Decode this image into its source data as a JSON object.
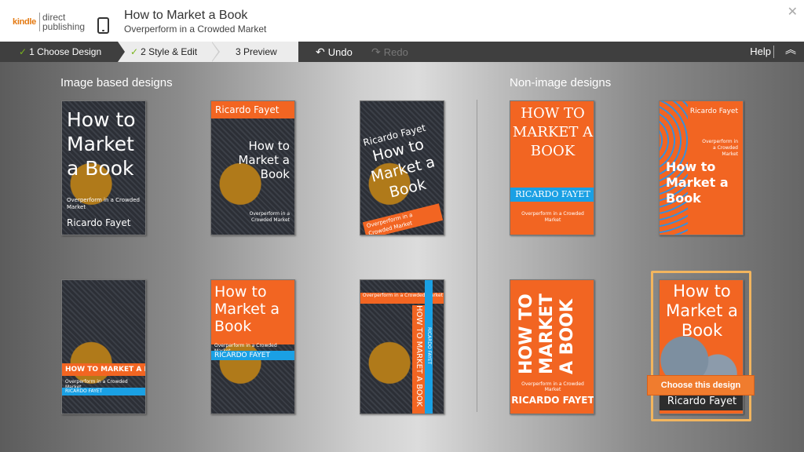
{
  "header": {
    "logo_kindle": "kindle",
    "logo_line1": "direct",
    "logo_line2": "publishing",
    "title": "How to Market a Book",
    "subtitle": "Overperform in a Crowded Market"
  },
  "toolbar": {
    "steps": [
      {
        "label": "1 Choose Design",
        "done": true
      },
      {
        "label": "2 Style & Edit",
        "done": true
      },
      {
        "label": "3 Preview",
        "done": false
      }
    ],
    "undo": "Undo",
    "redo": "Redo",
    "help": "Help"
  },
  "sections": {
    "image": "Image based designs",
    "nonimage": "Non-image designs"
  },
  "book": {
    "title": "How to Market a Book",
    "title_caps": "HOW TO MARKET A BOOK",
    "subtitle": "Overperform in a Crowded Market",
    "author": "Ricardo Fayet",
    "author_caps": "RICARDO FAYET"
  },
  "choose_button": "Choose this design",
  "colors": {
    "accent": "#f26522",
    "toolbar": "#3f3f3f",
    "check": "#7ab51d",
    "selected": "#f2b55e"
  }
}
